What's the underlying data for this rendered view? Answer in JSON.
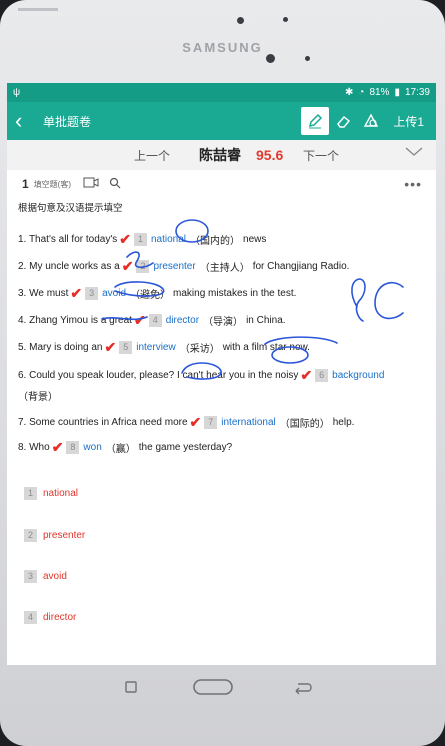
{
  "device": {
    "brand": "SAMSUNG"
  },
  "status_bar": {
    "battery": "81%",
    "time": "17:39"
  },
  "app_bar": {
    "title": "单批题卷",
    "upload_label": "上传1"
  },
  "nav": {
    "prev_label": "上一个",
    "next_label": "下一个",
    "student_name": "陈喆睿",
    "score": "95.6"
  },
  "question": {
    "number": "1",
    "type_label": "填空题(客)",
    "instruction": "根据句意及汉语提示填空",
    "items": [
      {
        "pre": "1. That's all for today's",
        "num": "1",
        "answer": "national",
        "hint": "（国内的）",
        "post": "news"
      },
      {
        "pre": "2. My uncle works as a",
        "num": "2",
        "answer": "presenter",
        "hint": "（主持人）",
        "post": "for Changjiang Radio."
      },
      {
        "pre": "3. We must",
        "num": "3",
        "answer": "avoid",
        "hint": "（避免）",
        "post": "making mistakes in the test."
      },
      {
        "pre": "4. Zhang Yimou is a great",
        "num": "4",
        "answer": "director",
        "hint": "（导演）",
        "post": "in China."
      },
      {
        "pre": "5. Mary is doing an",
        "num": "5",
        "answer": "interview",
        "hint": "（采访）",
        "post": "with a film star now."
      },
      {
        "pre": "6. Could you speak louder, please? I can't hear you in the noisy",
        "num": "6",
        "answer": "background",
        "hint": "（背景）",
        "post": ""
      },
      {
        "pre": "7. Some countries in Africa need more",
        "num": "7",
        "answer": "international",
        "hint": "（国际的）",
        "post": "help."
      },
      {
        "pre": "8. Who",
        "num": "8",
        "answer": "won",
        "hint": "（赢）",
        "post": "the game yesterday?"
      }
    ],
    "student_answers": [
      {
        "num": "1",
        "text": "national"
      },
      {
        "num": "2",
        "text": "presenter"
      },
      {
        "num": "3",
        "text": "avoid"
      },
      {
        "num": "4",
        "text": "director"
      }
    ]
  },
  "annotation": {
    "handwritten": "9C"
  },
  "colors": {
    "accent": "#1aa993",
    "check": "#e62e26",
    "answer": "#1a6fc9",
    "score": "#e13a2e"
  }
}
